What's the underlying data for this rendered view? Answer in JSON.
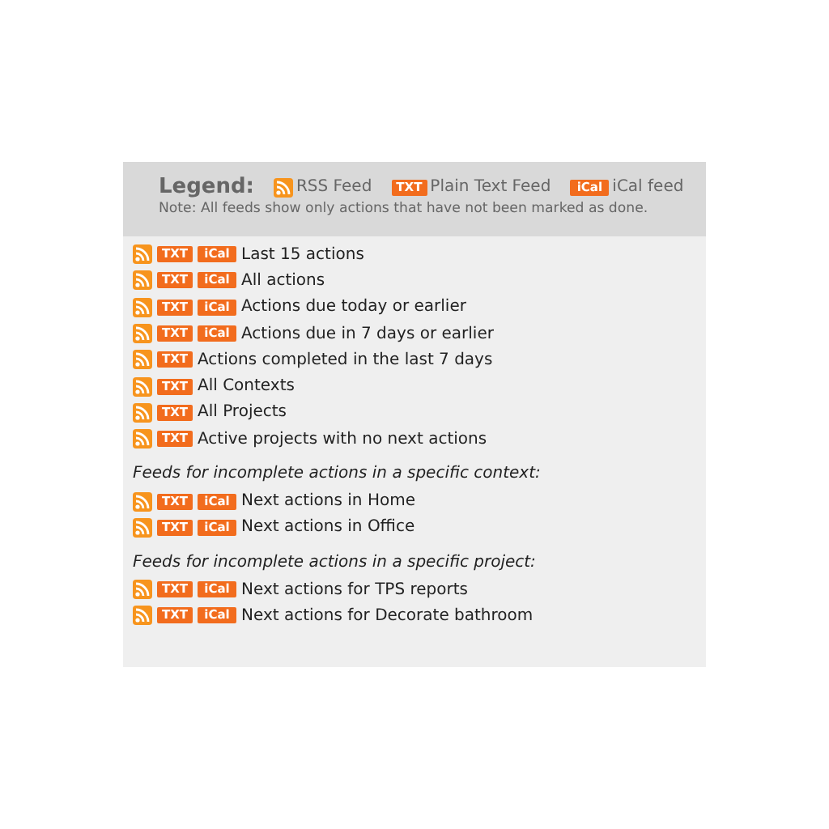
{
  "legend": {
    "title": "Legend:",
    "entries": [
      {
        "kind": "rss",
        "label": "RSS Feed"
      },
      {
        "kind": "txt",
        "badge": "TXT",
        "label": "Plain Text Feed"
      },
      {
        "kind": "ical",
        "badge": "iCal",
        "label": "iCal feed"
      }
    ],
    "note": "Note: All feeds show only actions that have not been marked as done."
  },
  "sections": [
    {
      "rows": [
        {
          "feeds": [
            {
              "kind": "rss"
            },
            {
              "kind": "txt",
              "badge": "TXT"
            },
            {
              "kind": "ical",
              "badge": "iCal"
            }
          ],
          "label": "Last 15 actions"
        },
        {
          "feeds": [
            {
              "kind": "rss"
            },
            {
              "kind": "txt",
              "badge": "TXT"
            },
            {
              "kind": "ical",
              "badge": "iCal"
            }
          ],
          "label": "All actions"
        },
        {
          "feeds": [
            {
              "kind": "rss"
            },
            {
              "kind": "txt",
              "badge": "TXT"
            },
            {
              "kind": "ical",
              "badge": "iCal"
            }
          ],
          "label": "Actions due today or earlier"
        },
        {
          "feeds": [
            {
              "kind": "rss"
            },
            {
              "kind": "txt",
              "badge": "TXT"
            },
            {
              "kind": "ical",
              "badge": "iCal"
            }
          ],
          "label": "Actions due in 7 days or earlier"
        },
        {
          "feeds": [
            {
              "kind": "rss"
            },
            {
              "kind": "txt",
              "badge": "TXT"
            }
          ],
          "label": "Actions completed in the last 7 days"
        },
        {
          "feeds": [
            {
              "kind": "rss"
            },
            {
              "kind": "txt",
              "badge": "TXT"
            }
          ],
          "label": "All Contexts"
        },
        {
          "feeds": [
            {
              "kind": "rss"
            },
            {
              "kind": "txt",
              "badge": "TXT"
            }
          ],
          "label": "All Projects"
        },
        {
          "feeds": [
            {
              "kind": "rss"
            },
            {
              "kind": "txt",
              "badge": "TXT"
            }
          ],
          "label": "Active projects with no next actions"
        }
      ]
    },
    {
      "heading": "Feeds for incomplete actions in a specific context:",
      "rows": [
        {
          "feeds": [
            {
              "kind": "rss"
            },
            {
              "kind": "txt",
              "badge": "TXT"
            },
            {
              "kind": "ical",
              "badge": "iCal"
            }
          ],
          "label": "Next actions in Home"
        },
        {
          "feeds": [
            {
              "kind": "rss"
            },
            {
              "kind": "txt",
              "badge": "TXT"
            },
            {
              "kind": "ical",
              "badge": "iCal"
            }
          ],
          "label": "Next actions in Office"
        }
      ]
    },
    {
      "heading": "Feeds for incomplete actions in a specific project:",
      "rows": [
        {
          "feeds": [
            {
              "kind": "rss"
            },
            {
              "kind": "txt",
              "badge": "TXT"
            },
            {
              "kind": "ical",
              "badge": "iCal"
            }
          ],
          "label": "Next actions for TPS reports"
        },
        {
          "feeds": [
            {
              "kind": "rss"
            },
            {
              "kind": "txt",
              "badge": "TXT"
            },
            {
              "kind": "ical",
              "badge": "iCal"
            }
          ],
          "label": "Next actions for Decorate bathroom"
        }
      ]
    }
  ]
}
